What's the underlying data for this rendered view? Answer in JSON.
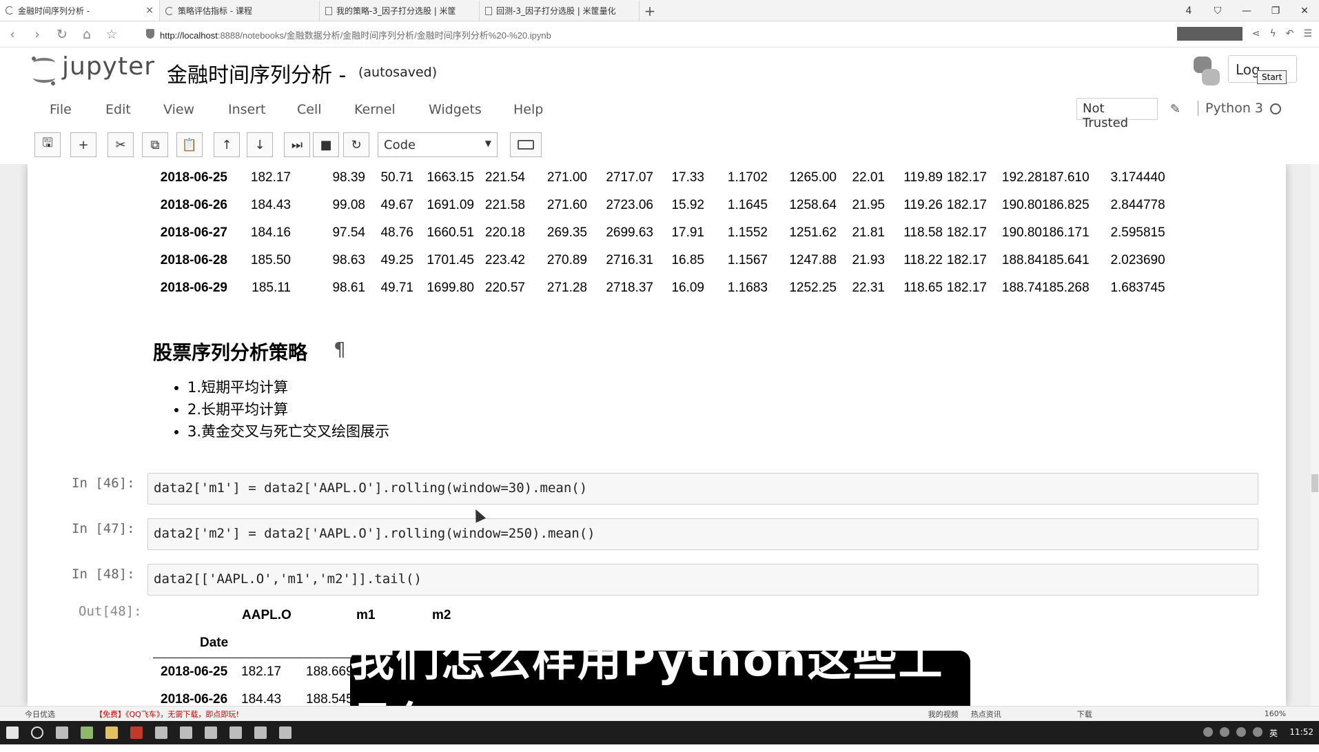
{
  "browser": {
    "tabs": [
      {
        "title": "金融时间序列分析 -",
        "active": true
      },
      {
        "title": "策略评估指标 - 课程",
        "active": false
      },
      {
        "title": "我的策略-3_因子打分选股 | 米筐",
        "active": false
      },
      {
        "title": "回测-3_因子打分选股 | 米筐量化",
        "active": false
      }
    ],
    "url_host": "http://localhost",
    "url_rest": ":8888/notebooks/金融数据分析/金融时间序列分析/金融时间序列分析%20-%20.ipynb",
    "tab_count": "4"
  },
  "jupyter": {
    "brand": "jupyter",
    "notebook_title": "金融时间序列分析 -",
    "autosave": "(autosaved)",
    "login_label": "Log",
    "start_label": "Start",
    "menu": [
      "File",
      "Edit",
      "View",
      "Insert",
      "Cell",
      "Kernel",
      "Widgets",
      "Help"
    ],
    "trusted": "Not Trusted",
    "kernel_name": "Python 3",
    "cell_type": "Code"
  },
  "top_table": {
    "rows": [
      {
        "date": "2018-06-25",
        "values": [
          "182.17",
          "98.39",
          "50.71",
          "1663.15",
          "221.54",
          "271.00",
          "2717.07",
          "17.33",
          "1.1702",
          "1265.00",
          "22.01",
          "119.89",
          "182.17",
          "192.28",
          "187.610",
          "3.174440"
        ]
      },
      {
        "date": "2018-06-26",
        "values": [
          "184.43",
          "99.08",
          "49.67",
          "1691.09",
          "221.58",
          "271.60",
          "2723.06",
          "15.92",
          "1.1645",
          "1258.64",
          "21.95",
          "119.26",
          "182.17",
          "190.80",
          "186.825",
          "2.844778"
        ]
      },
      {
        "date": "2018-06-27",
        "values": [
          "184.16",
          "97.54",
          "48.76",
          "1660.51",
          "220.18",
          "269.35",
          "2699.63",
          "17.91",
          "1.1552",
          "1251.62",
          "21.81",
          "118.58",
          "182.17",
          "190.80",
          "186.171",
          "2.595815"
        ]
      },
      {
        "date": "2018-06-28",
        "values": [
          "185.50",
          "98.63",
          "49.25",
          "1701.45",
          "223.42",
          "270.89",
          "2716.31",
          "16.85",
          "1.1567",
          "1247.88",
          "21.93",
          "118.22",
          "182.17",
          "188.84",
          "185.641",
          "2.023690"
        ]
      },
      {
        "date": "2018-06-29",
        "values": [
          "185.11",
          "98.61",
          "49.71",
          "1699.80",
          "220.57",
          "271.28",
          "2718.37",
          "16.09",
          "1.1683",
          "1252.25",
          "22.31",
          "118.65",
          "182.17",
          "188.74",
          "185.268",
          "1.683745"
        ]
      }
    ]
  },
  "markdown": {
    "title": "股票序列分析策略",
    "pilcrow": "¶",
    "items": [
      "1.短期平均计算",
      "2.长期平均计算",
      "3.黄金交叉与死亡交叉绘图展示"
    ]
  },
  "cells": [
    {
      "prompt": "In  [46]:",
      "code": "data2['m1'] = data2['AAPL.O'].rolling(window=30).mean()"
    },
    {
      "prompt": "In  [47]:",
      "code": "data2['m2'] = data2['AAPL.O'].rolling(window=250).mean()"
    },
    {
      "prompt": "In  [48]:",
      "code": "data2[['AAPL.O','m1','m2']].tail()"
    }
  ],
  "output": {
    "prompt": "Out[48]:",
    "columns": [
      "AAPL.O",
      "m1",
      "m2"
    ],
    "index_name": "Date",
    "rows": [
      {
        "date": "2018-06-25",
        "values": [
          "182.17",
          "188.669"
        ]
      },
      {
        "date": "2018-06-26",
        "values": [
          "184.43",
          "188.545"
        ]
      }
    ]
  },
  "subtitle": "我们怎么样用Python这些工具包",
  "statusbar": {
    "left": "今日优选",
    "news": "【免费】《QQ飞车》，无需下载，即点即玩!",
    "right_items": [
      "我的视频",
      "热点资讯",
      "下载"
    ],
    "zoom": "160%"
  },
  "taskbar": {
    "clock": "11:52",
    "lang": "英"
  }
}
